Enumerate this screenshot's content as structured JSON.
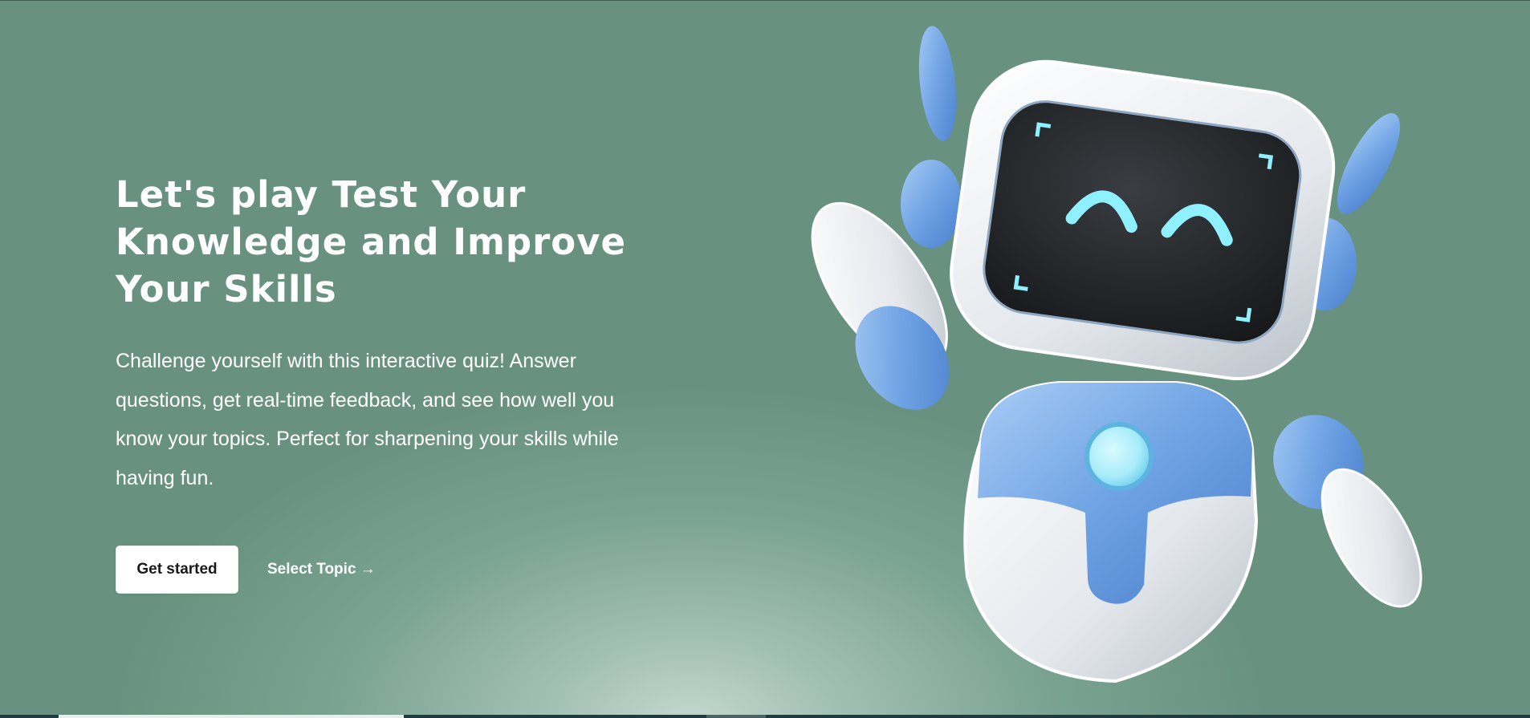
{
  "hero": {
    "title": "Let's play Test Your Knowledge and Improve Your Skills",
    "description": "Challenge yourself with this interactive quiz! Answer questions, get real-time feedback, and see how well you know your topics. Perfect for sharpening your skills while having fun.",
    "primary_button": "Get started",
    "secondary_link": "Select Topic →"
  },
  "illustration": {
    "icon": "robot-mascot-icon"
  },
  "colors": {
    "background": "#68927f",
    "glow": "#c4d8cd",
    "button_bg": "#ffffff",
    "button_text": "#1a1a1a",
    "robot_blue": "#6fa3e4",
    "robot_white": "#e8ecf0",
    "robot_screen": "#202326",
    "robot_eyes": "#8ff0ff"
  }
}
